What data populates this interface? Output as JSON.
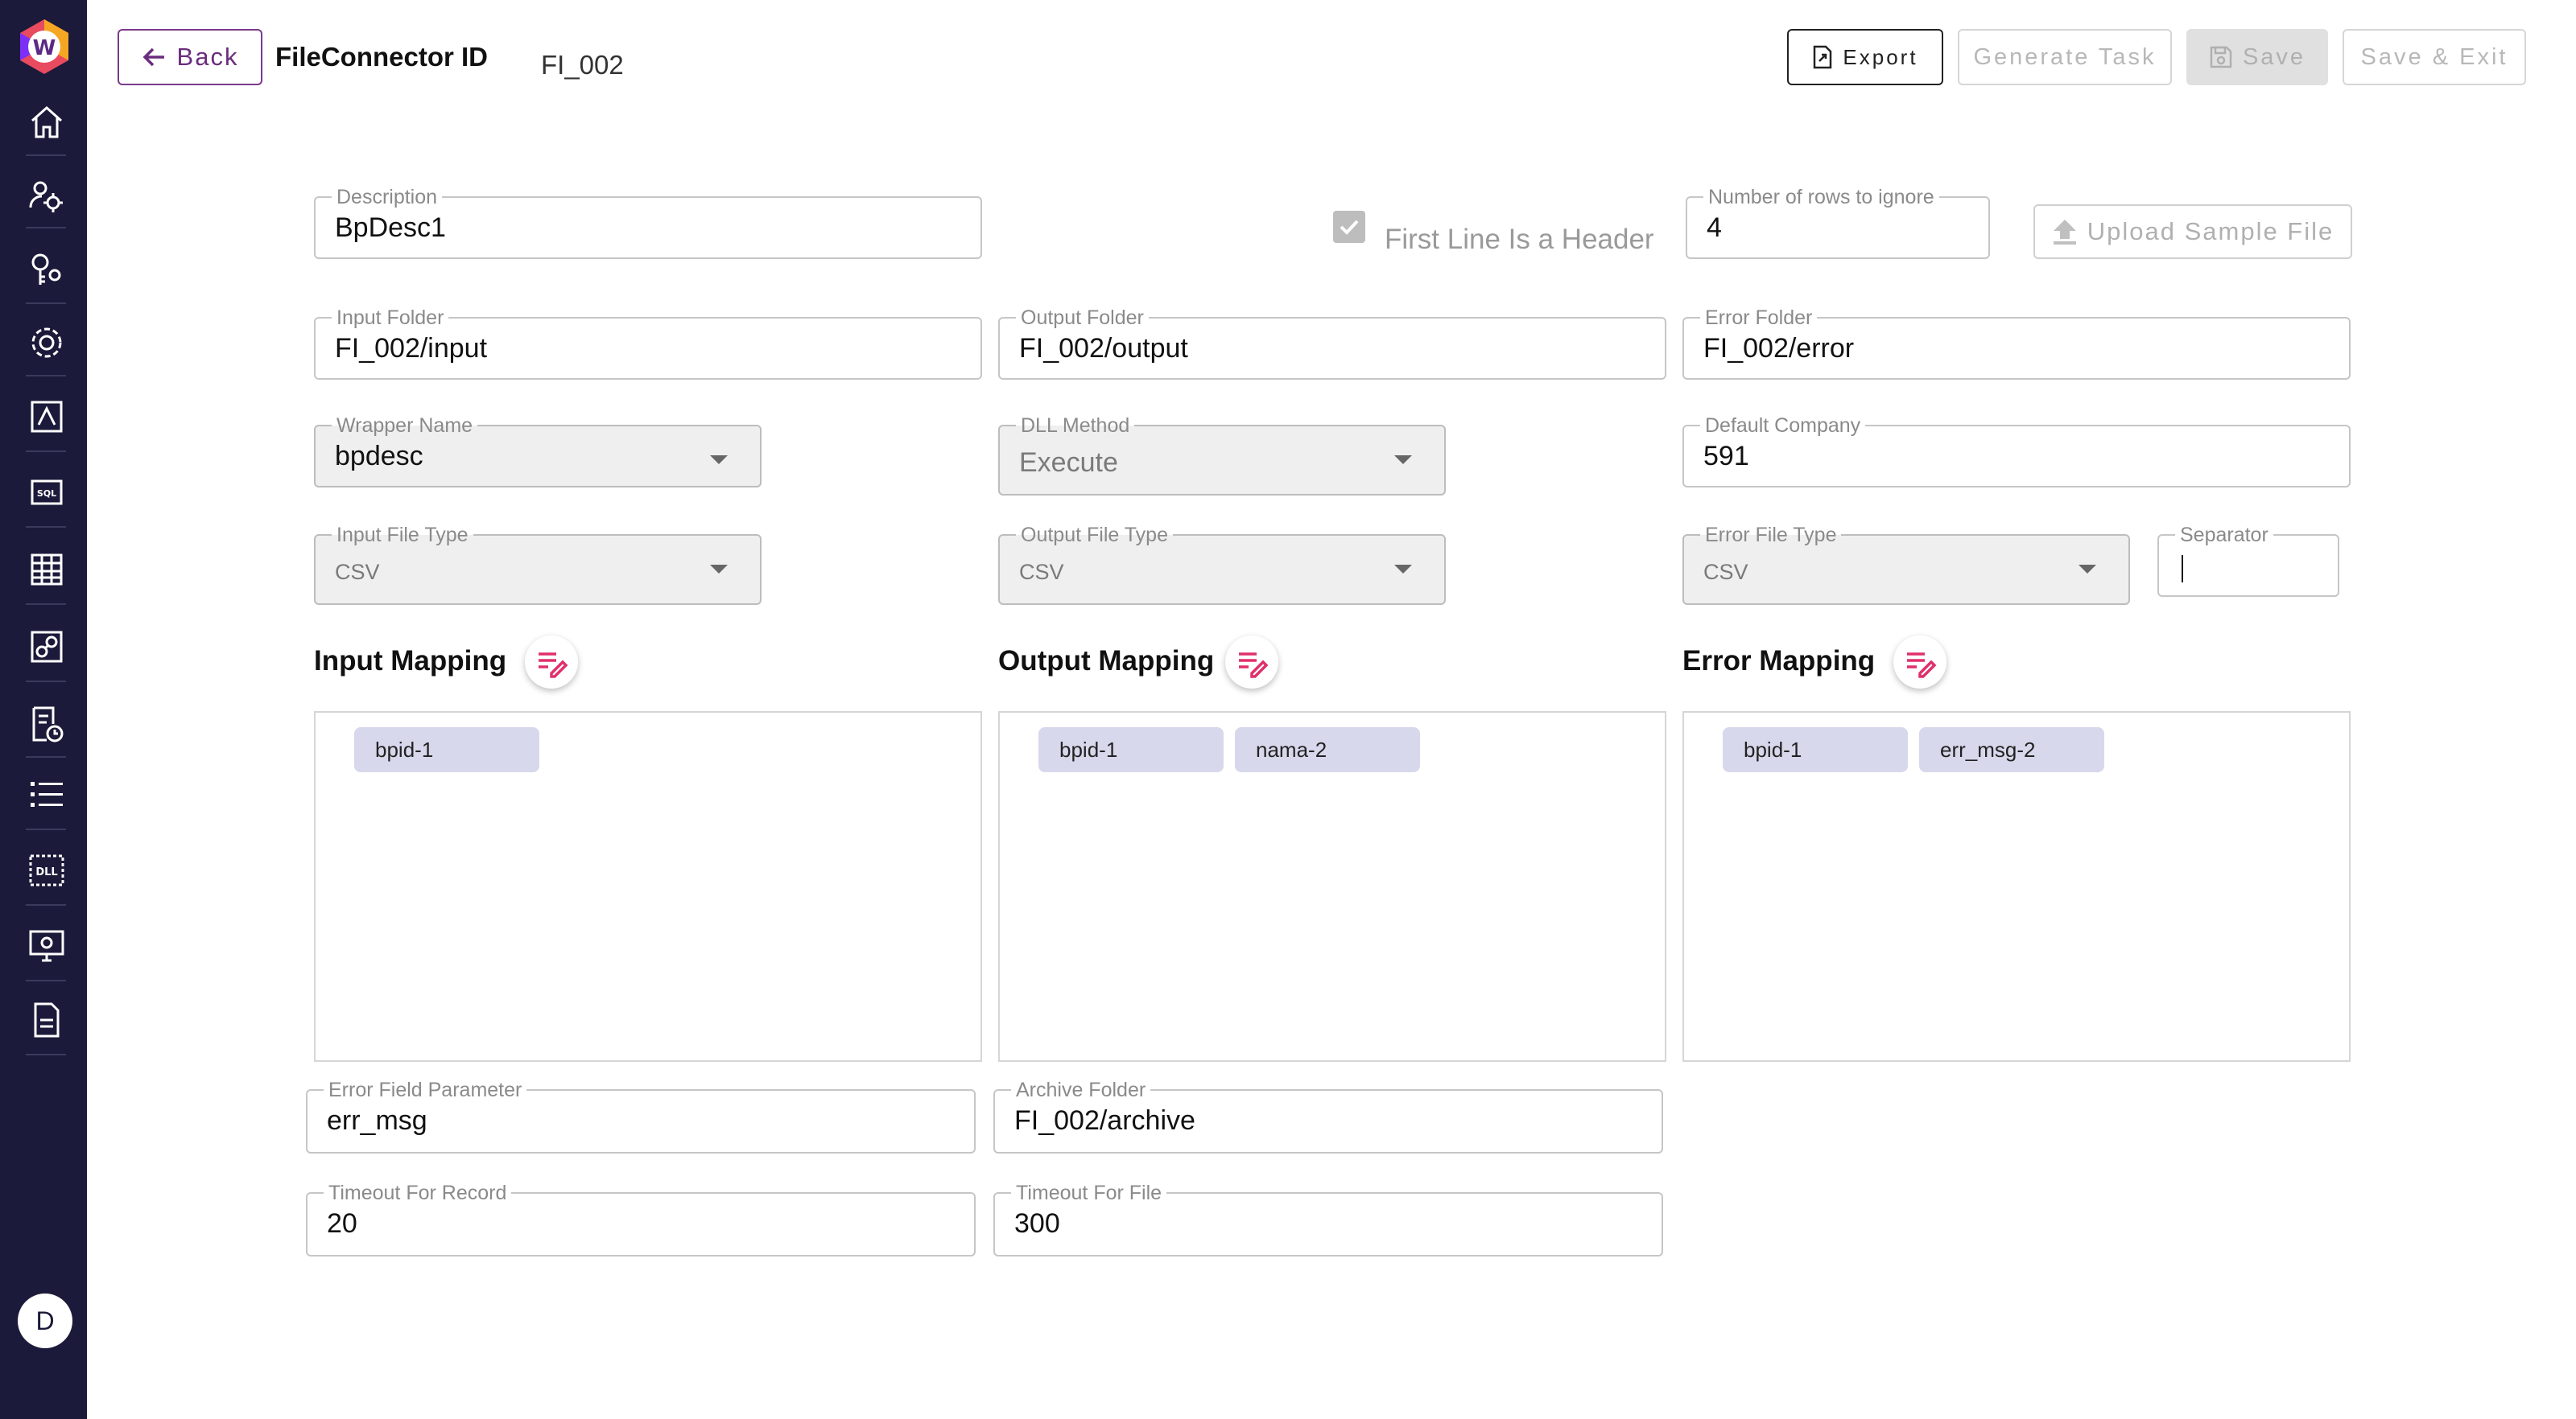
{
  "header": {
    "back_label": "Back",
    "title": "FileConnector ID",
    "id_value": "FI_002",
    "export_label": "Export",
    "generate_task_label": "Generate Task",
    "save_label": "Save",
    "save_exit_label": "Save & Exit"
  },
  "sidebar": {
    "items": [
      "home-icon",
      "users-gear-icon",
      "key-gear-icon",
      "gear-icon",
      "monitor-chart-icon",
      "sql-icon",
      "table-icon",
      "link-icon",
      "schedule-icon",
      "list-icon",
      "dll-icon",
      "desktop-settings-icon",
      "document-icon"
    ],
    "avatar_letter": "D"
  },
  "form": {
    "description": {
      "label": "Description",
      "value": "BpDesc1"
    },
    "first_line_header": {
      "label": "First Line Is a Header",
      "checked": true
    },
    "rows_to_ignore": {
      "label": "Number of rows to ignore",
      "value": "4"
    },
    "upload_label": "Upload Sample File",
    "input_folder": {
      "label": "Input Folder",
      "value": "FI_002/input"
    },
    "output_folder": {
      "label": "Output Folder",
      "value": "FI_002/output"
    },
    "error_folder": {
      "label": "Error Folder",
      "value": "FI_002/error"
    },
    "wrapper_name": {
      "label": "Wrapper Name",
      "value": "bpdesc"
    },
    "dll_method": {
      "label": "DLL Method",
      "value": "Execute"
    },
    "default_company": {
      "label": "Default Company",
      "value": "591"
    },
    "input_file_type": {
      "label": "Input File Type",
      "value": "CSV"
    },
    "output_file_type": {
      "label": "Output File Type",
      "value": "CSV"
    },
    "error_file_type": {
      "label": "Error File Type",
      "value": "CSV"
    },
    "separator": {
      "label": "Separator",
      "value": ""
    },
    "error_field_parameter": {
      "label": "Error Field Parameter",
      "value": "err_msg"
    },
    "archive_folder": {
      "label": "Archive Folder",
      "value": "FI_002/archive"
    },
    "timeout_record": {
      "label": "Timeout For Record",
      "value": "20"
    },
    "timeout_file": {
      "label": "Timeout For File",
      "value": "300"
    }
  },
  "mappings": {
    "input": {
      "title": "Input Mapping",
      "chips": [
        "bpid-1"
      ]
    },
    "output": {
      "title": "Output Mapping",
      "chips": [
        "bpid-1",
        "nama-2"
      ]
    },
    "error": {
      "title": "Error Mapping",
      "chips": [
        "bpid-1",
        "err_msg-2"
      ]
    }
  },
  "colors": {
    "sidebar_bg": "#1b1a3a",
    "accent_purple": "#7b3a8c",
    "edit_icon": "#e0306b",
    "chip_bg": "#d8d8ec"
  }
}
